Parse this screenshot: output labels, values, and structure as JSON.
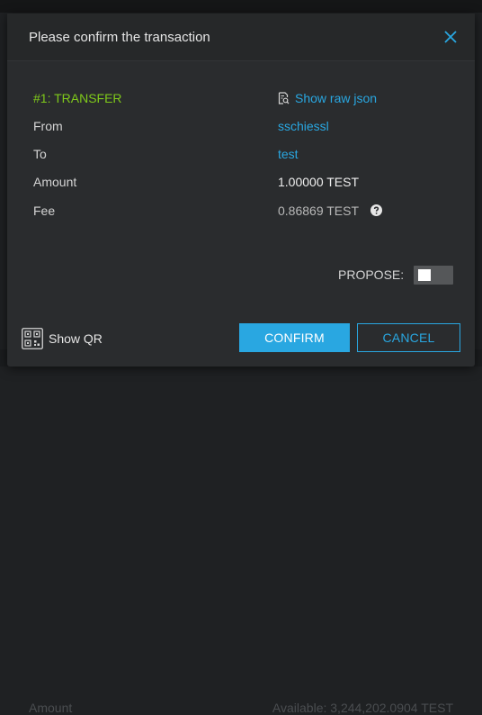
{
  "background": {
    "under_left": "Amount",
    "under_right": "Available: 3,244,202.0904 TEST"
  },
  "dialog": {
    "title": "Please confirm the transaction",
    "close_icon": "close-icon"
  },
  "operation": {
    "type_label": "#1: TRANSFER",
    "raw_json_label": "Show raw json",
    "fields": {
      "from_label": "From",
      "from_value": "sschiessl",
      "to_label": "To",
      "to_value": "test",
      "amount_label": "Amount",
      "amount_value": "1.00000 TEST",
      "fee_label": "Fee",
      "fee_value": "0.86869 TEST"
    }
  },
  "propose": {
    "label": "PROPOSE:",
    "enabled": false
  },
  "footer": {
    "show_qr_label": "Show QR",
    "confirm_label": "CONFIRM",
    "cancel_label": "CANCEL"
  },
  "colors": {
    "accent": "#29a7e1",
    "operation_green": "#7fc91a",
    "modal_bg": "#2a2c2e"
  }
}
